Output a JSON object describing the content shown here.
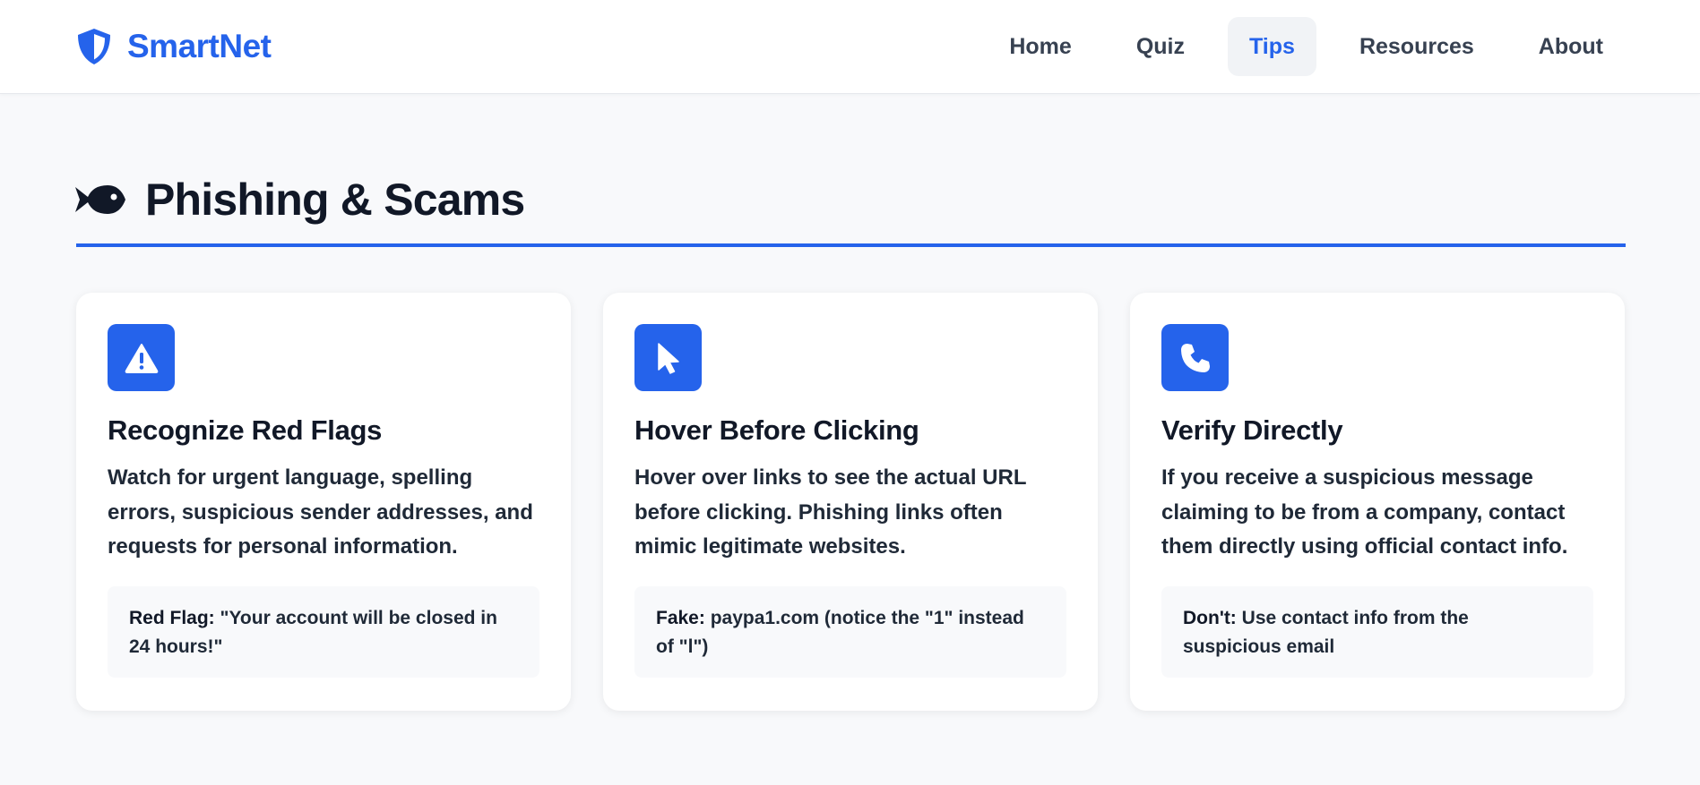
{
  "brand": {
    "name": "SmartNet",
    "icon": "shield-icon",
    "color": "#2563eb"
  },
  "nav": {
    "items": [
      {
        "label": "Home",
        "active": false
      },
      {
        "label": "Quiz",
        "active": false
      },
      {
        "label": "Tips",
        "active": true
      },
      {
        "label": "Resources",
        "active": false
      },
      {
        "label": "About",
        "active": false
      }
    ]
  },
  "section": {
    "icon": "fish-icon",
    "title": "Phishing & Scams"
  },
  "cards": [
    {
      "icon": "warning-triangle-icon",
      "title": "Recognize Red Flags",
      "text": "Watch for urgent language, spelling errors, suspicious sender addresses, and requests for personal information.",
      "example_label": "Red Flag:",
      "example_text": " \"Your account will be closed in 24 hours!\""
    },
    {
      "icon": "mouse-pointer-icon",
      "title": "Hover Before Clicking",
      "text": "Hover over links to see the actual URL before clicking. Phishing links often mimic legitimate websites.",
      "example_label": "Fake:",
      "example_text": " paypa1.com (notice the \"1\" instead of \"l\")"
    },
    {
      "icon": "phone-icon",
      "title": "Verify Directly",
      "text": "If you receive a suspicious message claiming to be from a company, contact them directly using official contact info.",
      "example_label": "Don't:",
      "example_text": " Use contact info from the suspicious email"
    }
  ],
  "colors": {
    "accent": "#2563eb",
    "page_bg": "#f8f9fb",
    "heading": "#111827"
  }
}
